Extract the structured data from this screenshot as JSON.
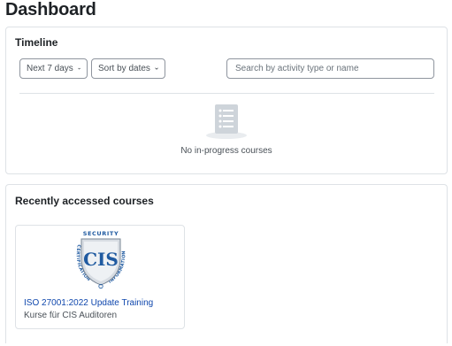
{
  "page": {
    "title": "Dashboard"
  },
  "timeline": {
    "title": "Timeline",
    "day_filter": "Next 7 days",
    "sort_filter": "Sort by dates",
    "search_placeholder": "Search by activity type or name",
    "empty_message": "No in-progress courses"
  },
  "recent": {
    "title": "Recently accessed courses",
    "courses": [
      {
        "name": "ISO 27001:2022 Update Training",
        "category": "Kurse für CIS Auditoren",
        "logo": {
          "top_text": "SECURITY",
          "left_text": "CERTIFICATION",
          "right_text": "INFORMATION",
          "mark": "CIS"
        }
      }
    ]
  },
  "colors": {
    "link": "#0f47ad",
    "border": "#dee2e6",
    "logo_blue": "#1f5aa0"
  }
}
